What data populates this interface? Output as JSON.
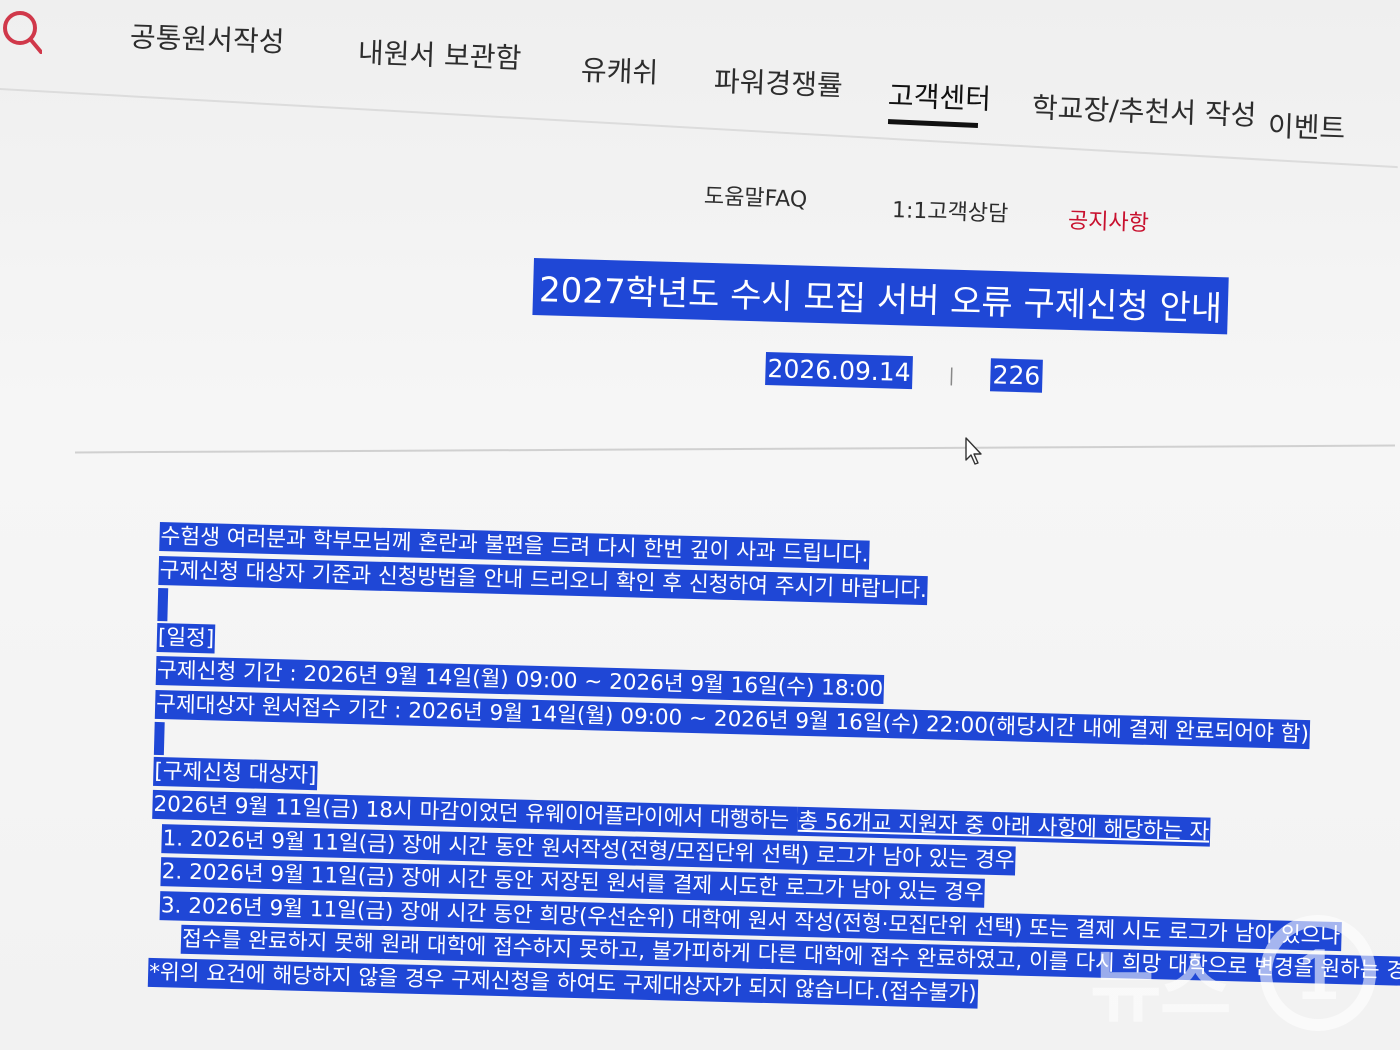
{
  "nav": {
    "items": [
      "공통원서작성",
      "내원서 보관함",
      "유캐쉬",
      "파워경쟁률",
      "고객센터",
      "학교장/추천서 작성",
      "이벤트"
    ],
    "active": "고객센터",
    "search_icon": "search-icon"
  },
  "subnav": {
    "items": [
      "도움말FAQ",
      "1:1고객상담",
      "공지사항"
    ],
    "active": "공지사항"
  },
  "article": {
    "title": "2027학년도 수시 모집 서버 오류 구제신청 안내",
    "date": "2026.09.14",
    "separator": "|",
    "views": "226",
    "body": {
      "intro1": "수험생 여러분과 학부모님께 혼란과 불편을 드려 다시 한번 깊이 사과 드립니다.",
      "intro2": "구제신청 대상자 기준과 신청방법을 안내 드리오니 확인 후 신청하여 주시기 바랍니다.",
      "schedule_heading": "[일정]",
      "schedule1": "구제신청 기간 : 2026년 9월 14일(월) 09:00 ~ 2026년 9월 16일(수) 18:00",
      "schedule2": "구제대상자 원서접수 기간 : 2026년 9월 14일(월) 09:00 ~ 2026년 9월 16일(수) 22:00(해당시간 내에 결제 완료되어야 함)",
      "target_heading": "[구제신청 대상자]",
      "target_intro_a": "2026년 9월 11일(금) 18시 마감이었던 유웨이어플라이에서 대행하는 ",
      "target_intro_b": "총 56개교 지원자 중 아래 사항에 해당하는 자",
      "item1": "1. 2026년 9월 11일(금) 장애 시간 동안 원서작성(전형/모집단위 선택) 로그가 남아 있는 경우",
      "item2": "2. 2026년 9월 11일(금) 장애 시간 동안 저장된 원서를 결제 시도한 로그가 남아 있는 경우",
      "item3a": "3. 2026년 9월 11일(금) 장애 시간 동안 희망(우선순위) 대학에 원서 작성(전형·모집단위 선택) 또는 결제 시도 로그가 남아 있으나",
      "item3b": "접수를 완료하지 못해 원래 대학에 접수하지 못하고, 불가피하게 다른 대학에 접수 완료하였고, 이를 다시 희망 대학으로 변경을 원하는 경우",
      "note": "*위의 요건에 해당하지 않을 경우 구제신청을 하여도 구제대상자가 되지 않습니다.(접수불가)"
    }
  },
  "watermark": {
    "text": "뉴스",
    "logo_glyph": "1"
  },
  "colors": {
    "selection": "#1f47d6",
    "active_sub": "#c8102e",
    "search_icon": "#d0384a"
  }
}
